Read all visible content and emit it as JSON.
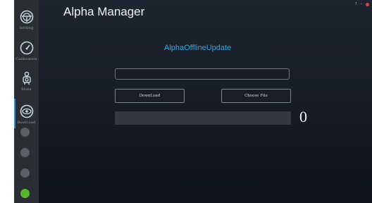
{
  "app": {
    "title": "Alpha Manager"
  },
  "window_controls": {
    "help": "?",
    "minimize": "–"
  },
  "sidebar": {
    "items": [
      {
        "label": "Setting",
        "icon": "steering-wheel-icon"
      },
      {
        "label": "Calibration",
        "icon": "gauge-icon"
      },
      {
        "label": "State",
        "icon": "robot-icon"
      },
      {
        "label": "BootLoad",
        "icon": "eye-icon",
        "active": true
      }
    ],
    "status_dots": [
      "#5b6066",
      "#5b6066",
      "#5b6066",
      "#57b52e"
    ]
  },
  "main": {
    "section_title": "AlphaOfflineUpdate",
    "file_path": {
      "value": "",
      "placeholder": ""
    },
    "download_label": "DownLoad",
    "choose_file_label": "Choose File",
    "progress": {
      "fraction": 0,
      "value_text": "0"
    }
  }
}
